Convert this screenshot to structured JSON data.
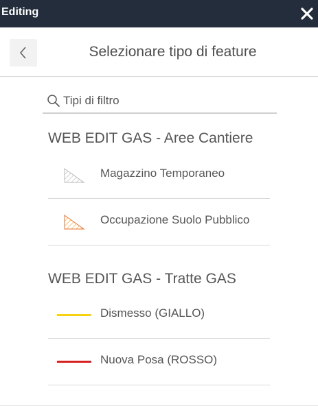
{
  "window": {
    "title": "Editing",
    "close_icon": "close-icon"
  },
  "header": {
    "back_icon": "chevron-left-icon",
    "title": "Selezionare tipo di feature"
  },
  "search": {
    "icon": "search-icon",
    "placeholder": "Tipi di filtro",
    "value": ""
  },
  "groups": [
    {
      "title": "WEB EDIT GAS - Aree Cantiere",
      "items": [
        {
          "label": "Magazzino Temporaneo",
          "symbol": "hatched-polygon-gray",
          "color": "#b8b8b8"
        },
        {
          "label": "Occupazione Suolo Pubblico",
          "symbol": "hatched-polygon-orange",
          "color": "#e8702a"
        }
      ]
    },
    {
      "title": "WEB EDIT GAS - Tratte GAS",
      "items": [
        {
          "label": "Dismesso (GIALLO)",
          "symbol": "line-yellow",
          "color": "#f5d40f"
        },
        {
          "label": "Nuova Posa (ROSSO)",
          "symbol": "line-red",
          "color": "#d92020"
        }
      ]
    }
  ]
}
